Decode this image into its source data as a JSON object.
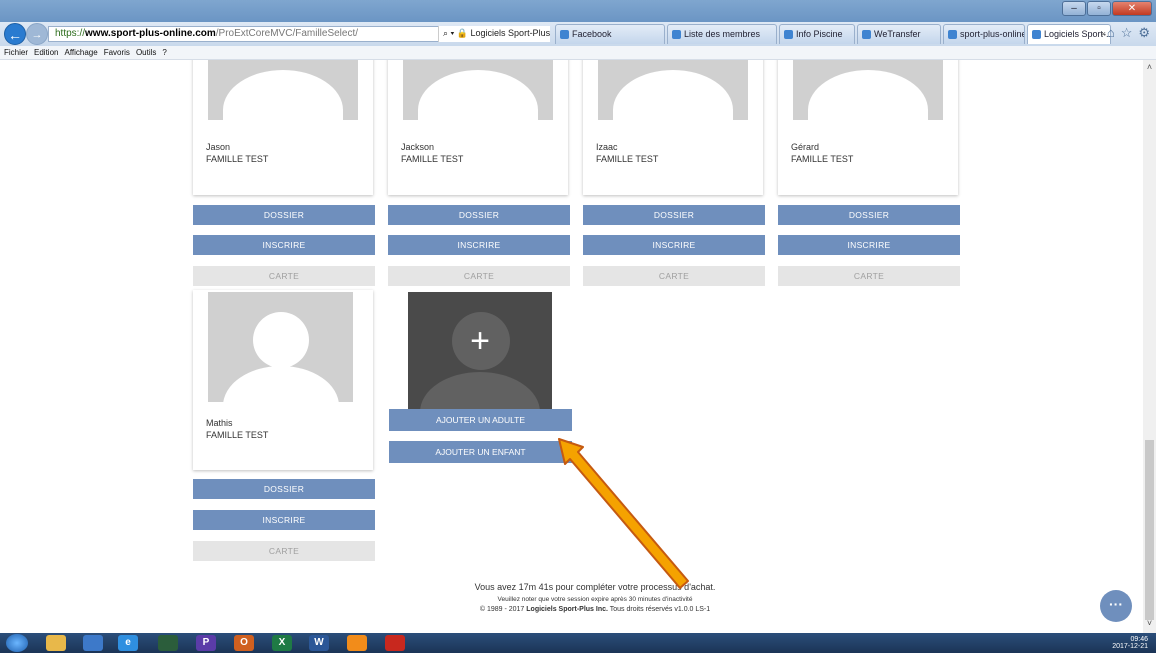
{
  "browser": {
    "url_secure": "https://",
    "url_domain": "www.sport-plus-online.com",
    "url_path": "/ProExtCoreMVC/FamilleSelect/",
    "search_text": "Logiciels Sport-Plus Inc. [CA]",
    "tabs": [
      {
        "label": "Facebook"
      },
      {
        "label": "Liste des membres"
      },
      {
        "label": "Info Piscine"
      },
      {
        "label": "WeTransfer"
      },
      {
        "label": "sport-plus-online.c..."
      },
      {
        "label": "Logiciels Sport-..."
      }
    ],
    "menu": [
      "Fichier",
      "Edition",
      "Affichage",
      "Favoris",
      "Outils",
      "?"
    ]
  },
  "members": [
    {
      "first_name": "Jason",
      "last_name": "FAMILLE TEST"
    },
    {
      "first_name": "Jackson",
      "last_name": "FAMILLE TEST"
    },
    {
      "first_name": "Izaac",
      "last_name": "FAMILLE TEST"
    },
    {
      "first_name": "Gérard",
      "last_name": "FAMILLE TEST"
    },
    {
      "first_name": "Mathis",
      "last_name": "FAMILLE TEST"
    }
  ],
  "buttons": {
    "dossier": "DOSSIER",
    "inscrire": "INSCRIRE",
    "carte": "CARTE",
    "add_adult": "AJOUTER UN ADULTE",
    "add_child": "AJOUTER UN ENFANT",
    "plus": "+",
    "chat": "···"
  },
  "footer": {
    "timer_prefix": "Vous avez ",
    "timer_value": "17m 41s",
    "timer_suffix": " pour compléter votre processus d'achat.",
    "session_note": "Veuillez noter que votre session expire après 30 minutes d'inactivité",
    "copyright_prefix": "© 1989 - 2017 ",
    "company": "Logiciels Sport-Plus Inc.",
    "copyright_suffix": " Tous droits réservés v1.0.0 LS-1"
  },
  "taskbar": {
    "time": "09:46",
    "date": "2017-12-21"
  },
  "colors": {
    "button": "#6f8fbd",
    "disabled": "#e5e5e5",
    "arrow_fill": "#f5a200",
    "arrow_stroke": "#c55a11"
  }
}
